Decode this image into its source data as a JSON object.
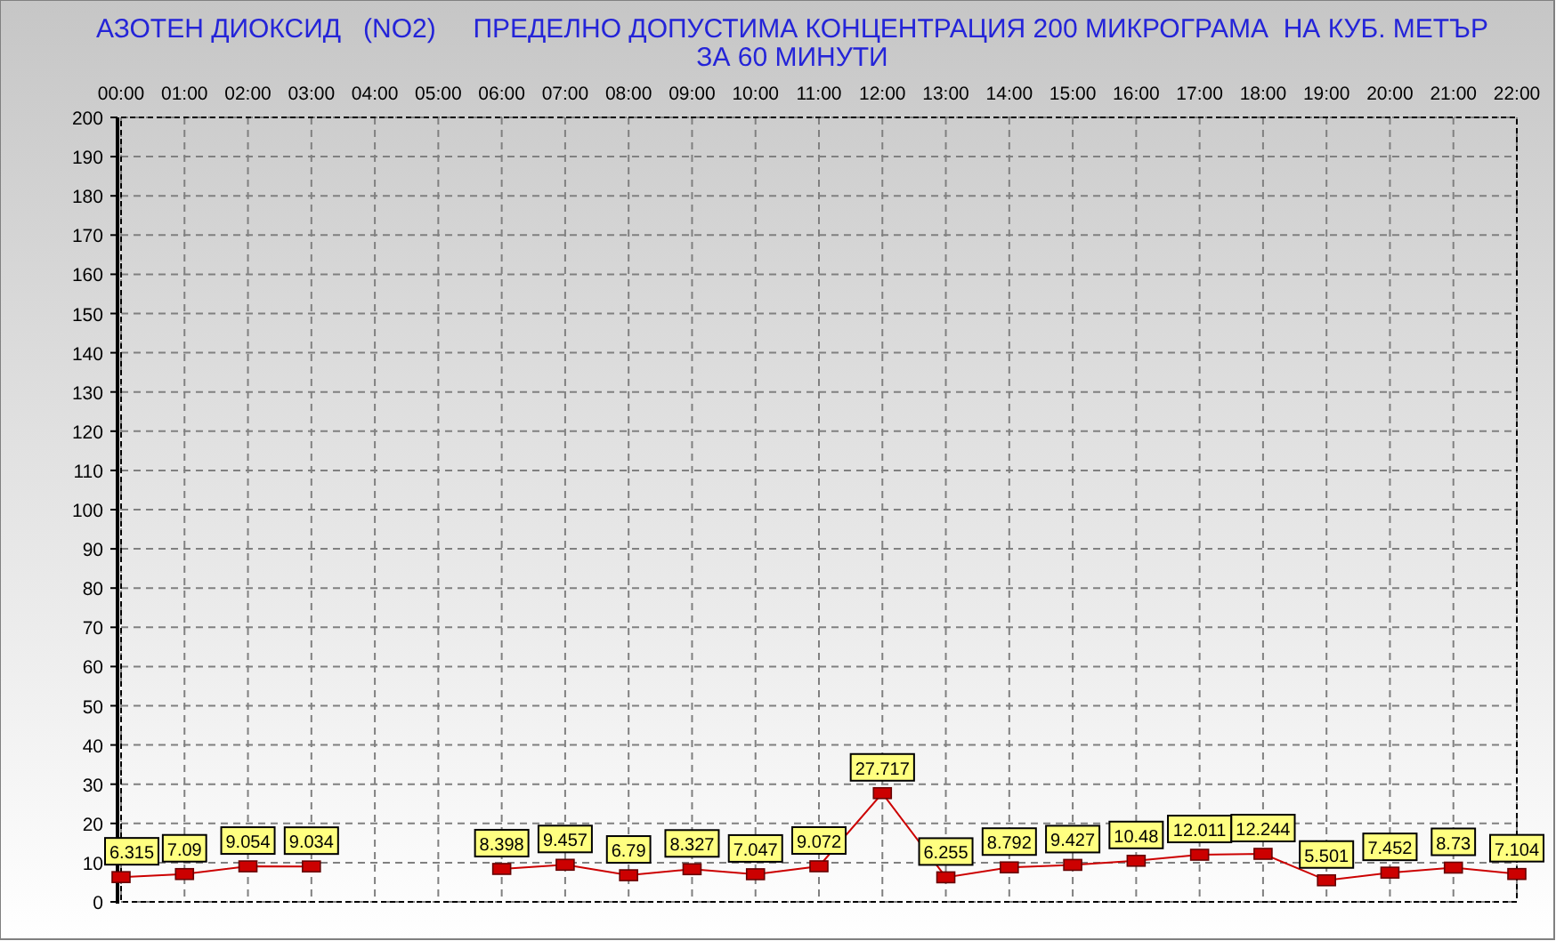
{
  "chart_data": {
    "type": "line",
    "title": "АЗОТЕН ДИОКСИД   (NO2)     ПРЕДЕЛНО ДОПУСТИМА КОНЦЕНТРАЦИЯ 200 МИКРОГРАМА  НА КУБ. МЕТЪР",
    "subtitle": "ЗА 60 МИНУТИ",
    "categories": [
      "00:00",
      "01:00",
      "02:00",
      "03:00",
      "04:00",
      "05:00",
      "06:00",
      "07:00",
      "08:00",
      "09:00",
      "10:00",
      "11:00",
      "12:00",
      "13:00",
      "14:00",
      "15:00",
      "16:00",
      "17:00",
      "18:00",
      "19:00",
      "20:00",
      "21:00",
      "22:00"
    ],
    "series": [
      {
        "color": "#cc0000",
        "marker": "square",
        "values": [
          6.315,
          7.09,
          9.054,
          9.034,
          null,
          null,
          8.398,
          9.457,
          6.79,
          8.327,
          7.047,
          9.072,
          27.717,
          6.255,
          8.792,
          9.427,
          10.48,
          12.011,
          12.244,
          5.501,
          7.452,
          8.73,
          7.104
        ]
      }
    ],
    "ylim": [
      0,
      200
    ],
    "yticks": [
      0,
      10,
      20,
      30,
      40,
      50,
      60,
      70,
      80,
      90,
      100,
      110,
      120,
      130,
      140,
      150,
      160,
      170,
      180,
      190,
      200
    ],
    "grid": true,
    "data_labels": true
  }
}
